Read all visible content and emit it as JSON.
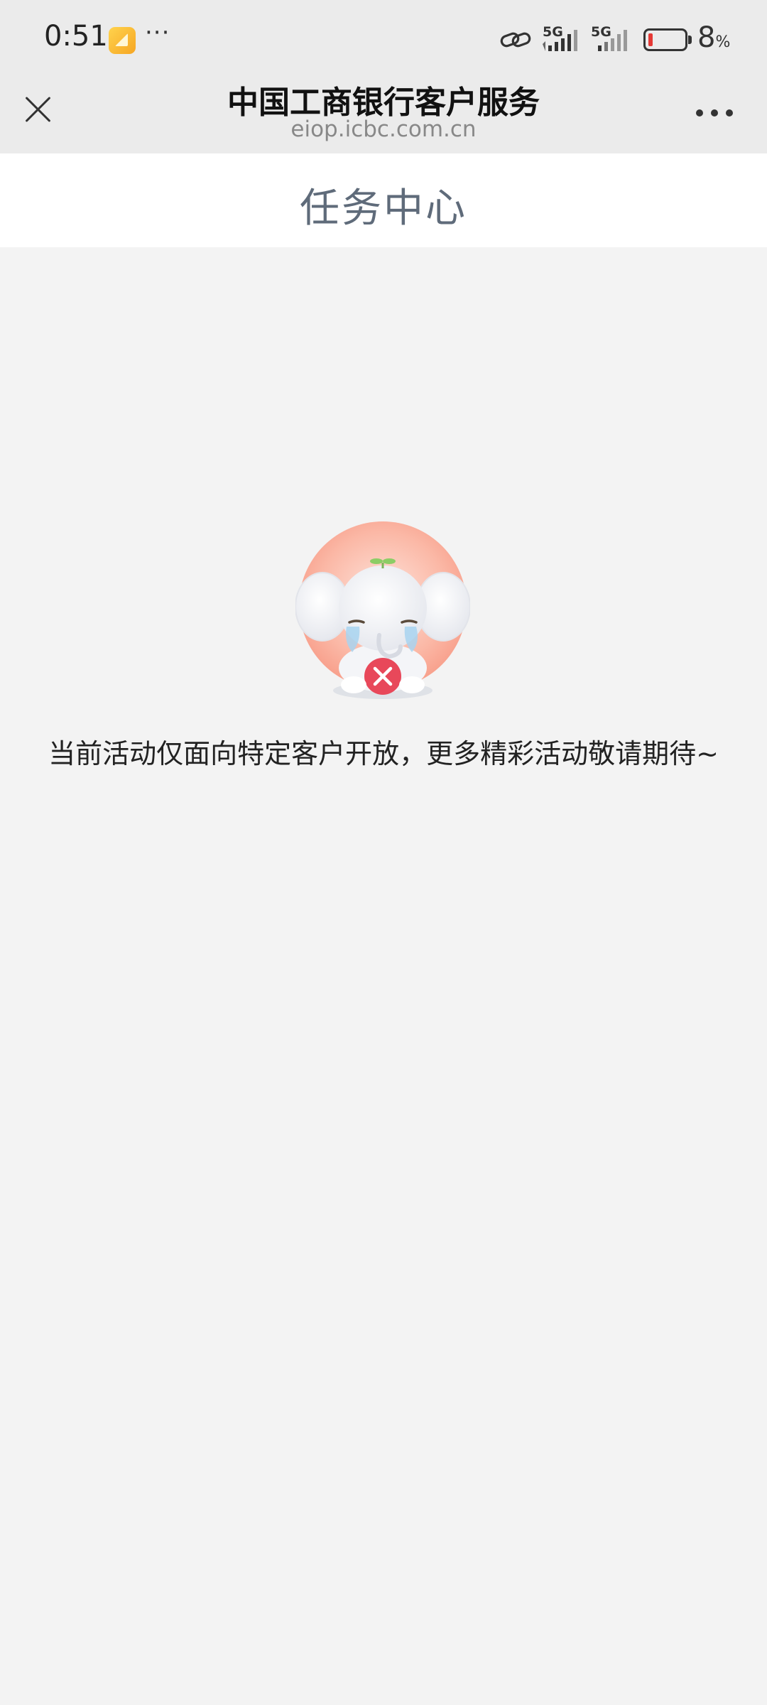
{
  "status_bar": {
    "time": "0:51",
    "dots": "···",
    "network_1": "5G",
    "network_2": "5G",
    "battery_level": "8",
    "battery_unit": "%"
  },
  "title_bar": {
    "title": "中国工商银行客户服务",
    "url": "eiop.icbc.com.cn"
  },
  "header": {
    "title": "任务中心"
  },
  "main": {
    "message": "当前活动仅面向特定客户开放，更多精彩活动敬请期待~"
  },
  "colors": {
    "header_title": "#5f6b7a",
    "error_badge": "#e8485a",
    "battery_low": "#e53935"
  }
}
